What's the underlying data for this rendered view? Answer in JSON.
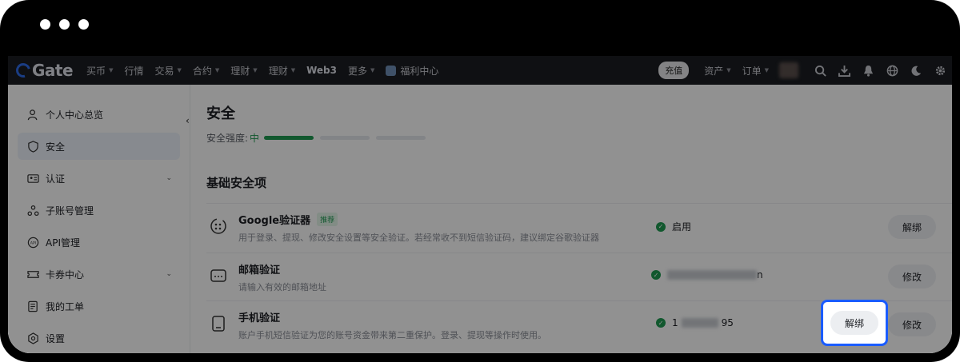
{
  "nav": {
    "logo": "Gate",
    "items": [
      {
        "label": "买币",
        "caret": true
      },
      {
        "label": "行情",
        "caret": false
      },
      {
        "label": "交易",
        "caret": true
      },
      {
        "label": "合约",
        "caret": true
      },
      {
        "label": "理财",
        "caret": true
      },
      {
        "label": "理财",
        "caret": true
      },
      {
        "label": "Web3",
        "caret": false
      },
      {
        "label": "更多",
        "caret": true
      }
    ],
    "welfare": "福利中心",
    "deposit": "充值",
    "assets": "资产",
    "orders": "订单",
    "icons": [
      "search-icon",
      "download-icon",
      "bell-icon",
      "globe-icon",
      "moon-icon",
      "gear-icon"
    ]
  },
  "sidebar": {
    "items": [
      {
        "label": "个人中心总览",
        "icon": "user-icon",
        "active": false,
        "chevron": false
      },
      {
        "label": "安全",
        "icon": "shield-icon",
        "active": true,
        "chevron": false
      },
      {
        "label": "认证",
        "icon": "id-card-icon",
        "active": false,
        "chevron": true
      },
      {
        "label": "子账号管理",
        "icon": "sub-account-icon",
        "active": false,
        "chevron": false
      },
      {
        "label": "API管理",
        "icon": "api-icon",
        "active": false,
        "chevron": false
      },
      {
        "label": "卡券中心",
        "icon": "coupon-icon",
        "active": false,
        "chevron": true
      },
      {
        "label": "我的工单",
        "icon": "ticket-icon",
        "active": false,
        "chevron": false
      },
      {
        "label": "设置",
        "icon": "settings-icon",
        "active": false,
        "chevron": false
      }
    ]
  },
  "main": {
    "title": "安全",
    "strength_label": "安全强度:",
    "strength_value": "中",
    "strength_level": 1,
    "strength_total": 3,
    "section_title": "基础安全项",
    "rows": [
      {
        "title": "Google验证器",
        "tag": "推荐",
        "desc": "用于登录、提现、修改安全设置等安全验证。若经常收不到短信验证码，建议绑定谷歌验证器",
        "status": "启用",
        "buttons": [
          "解绑"
        ]
      },
      {
        "title": "邮箱验证",
        "tag": "",
        "desc": "请输入有效的邮箱地址",
        "status_suffix": "n",
        "buttons": [
          "修改"
        ]
      },
      {
        "title": "手机验证",
        "tag": "",
        "desc": "账户手机短信验证为您的账号资金带来第二重保护。登录、提现等操作时使用。",
        "status_prefix": "1",
        "status_suffix": "95",
        "buttons": [
          "解绑",
          "修改"
        ]
      }
    ]
  },
  "colors": {
    "accent_green": "#1f9b52",
    "highlight_blue": "#1a5cff"
  }
}
